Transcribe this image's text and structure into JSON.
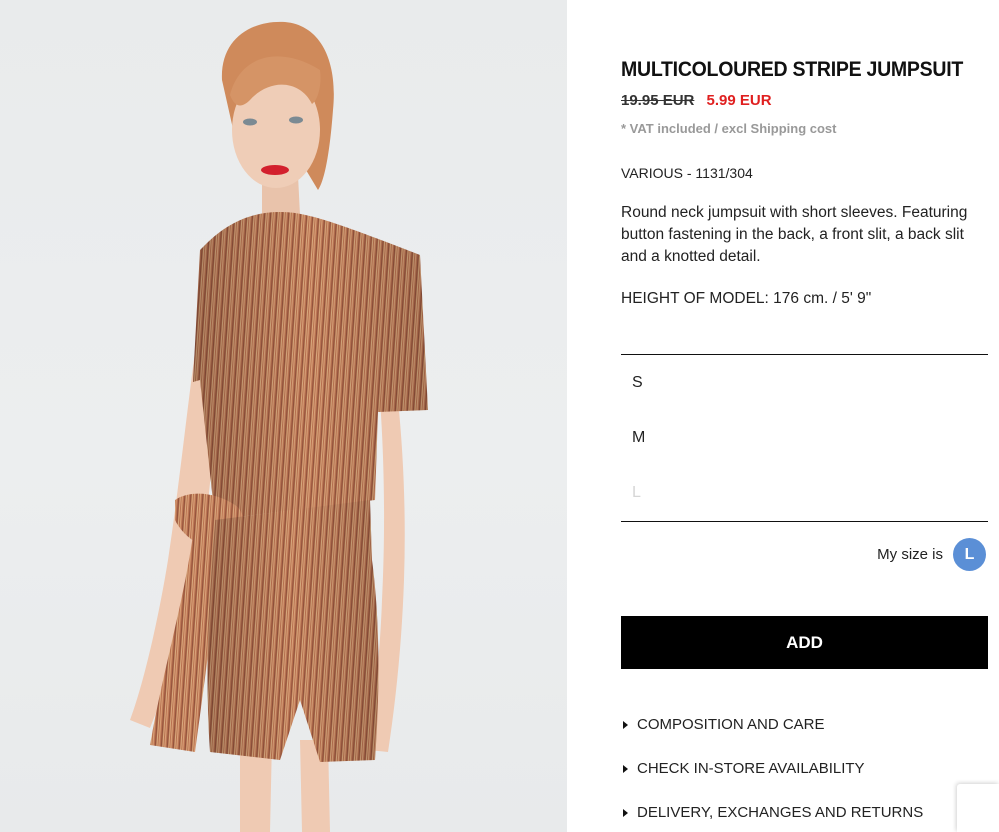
{
  "product": {
    "title": "MULTICOLOURED STRIPE JUMPSUIT",
    "old_price": "19.95 EUR",
    "new_price": "5.99 EUR",
    "vat_note": "* VAT included / excl Shipping cost",
    "reference": "VARIOUS - 1131/304",
    "description": "Round neck jumpsuit with short sleeves. Featuring button fastening in the back, a front slit, a back slit and a knotted detail.",
    "model_height": "HEIGHT OF MODEL: 176 cm. / 5' 9\""
  },
  "sizes": [
    {
      "label": "S",
      "available": true
    },
    {
      "label": "M",
      "available": true
    },
    {
      "label": "L",
      "available": false
    }
  ],
  "my_size": {
    "label": "My size is",
    "value": "L",
    "badge_color": "#5b8fd6"
  },
  "add_button": "ADD",
  "accordion": [
    "COMPOSITION AND CARE",
    "CHECK IN-STORE AVAILABILITY",
    "DELIVERY, EXCHANGES AND RETURNS"
  ],
  "colors": {
    "sale_price": "#e02020",
    "photo_background": "#eceeef"
  }
}
